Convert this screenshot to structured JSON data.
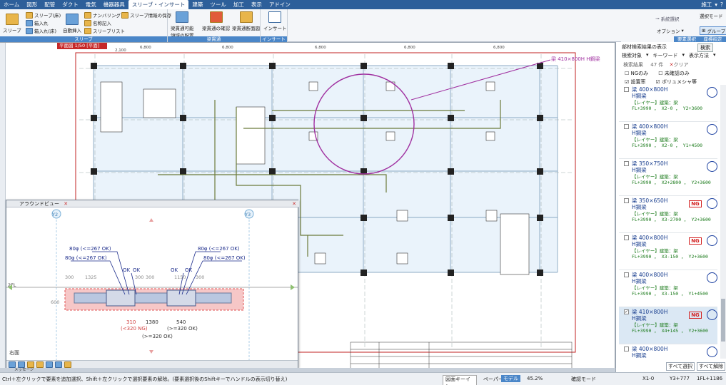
{
  "menu": {
    "items": [
      "ホーム",
      "図形",
      "配管",
      "ダクト",
      "電気",
      "機器器具",
      "スリーブ・インサート",
      "建築",
      "ツール",
      "加工",
      "表示",
      "アドイン"
    ],
    "active_index": 6,
    "right_label": "施工"
  },
  "ribbon": {
    "groups": [
      {
        "caption": "スリーブ",
        "buttons": [
          "スリーブ",
          "スリーブ(床)",
          "箱入れ",
          "箱入れ(床)",
          "自動挿入",
          "ナンバリング",
          "名称記入",
          "スリーブリスト",
          "スリーブ情報の保存"
        ]
      },
      {
        "caption": "梁貫通",
        "buttons": [
          "梁貫通可能\n領域の配置",
          "梁貫通の確認",
          "梁貫通断面図"
        ]
      },
      {
        "caption": "インサート",
        "buttons": [
          "インサート"
        ]
      }
    ],
    "right": {
      "system_select": "系統選択",
      "select_mode": "選択モード",
      "option": "オプション",
      "group": "グループ",
      "caption1": "要素選択",
      "caption2": "座標指定"
    }
  },
  "drawing": {
    "tab": "平面図 1/50 [平面]",
    "callout": "梁 410×800H H鋼梁",
    "dims_top": [
      "2,100",
      "6,800",
      "6,800",
      "6,800",
      "6,800",
      "6,800",
      "6,800",
      "2,100"
    ],
    "grid_top": [
      "X1",
      "X2",
      "X3",
      "X4",
      "X5",
      "X6"
    ],
    "grid_left": [
      "Y3",
      "Y2",
      "Y1"
    ]
  },
  "popup": {
    "title": "アラウンドビュー",
    "grid_left": "Y2",
    "grid_right": "Y3",
    "level": "2FL",
    "labels": [
      "80φ (<=267 OK)",
      "80φ (<=267 OK)",
      "80φ (<=267 OK)",
      "80φ (<=267 OK)",
      "OK",
      "OK",
      "OK",
      "OK"
    ],
    "dims": [
      "300",
      "1325",
      "300",
      "300",
      "1150",
      "300",
      "600",
      "310",
      "1380",
      "540"
    ],
    "ng_text": "(<320 NG)",
    "ok_text1": "(>=320 OK)",
    "ok_text2": "(>=320 OK)",
    "bottom_label": "右面"
  },
  "panel": {
    "header": "部材検索結果の表示",
    "search_btn": "検索",
    "filters": [
      "検索対象",
      "キーワード",
      "表示方法"
    ],
    "result_label": "検索結果",
    "result_count": "47 件",
    "clear": "クリア",
    "checks": [
      "NGのみ",
      "未確認のみ",
      "設置率",
      "ボリュメシャ等"
    ],
    "cards": [
      {
        "l1": "梁 400×800H",
        "l2": "H鋼梁",
        "l3": "【レイヤー】建築：梁",
        "l4": "FL+3990 ， X2-0 ， Y2+3600",
        "ng": false,
        "sel": false
      },
      {
        "l1": "梁 400×800H",
        "l2": "H鋼梁",
        "l3": "【レイヤー】建築：梁",
        "l4": "FL+3990 ， X2-0 ， Y1+4500",
        "ng": false,
        "sel": false
      },
      {
        "l1": "梁 350×750H",
        "l2": "H鋼梁",
        "l3": "【レイヤー】建築：梁",
        "l4": "FL+3990 ， X2+2800 ， Y2+3600",
        "ng": false,
        "sel": false
      },
      {
        "l1": "梁 350×650H",
        "l2": "H鋼梁",
        "l3": "【レイヤー】建築：梁",
        "l4": "FL+3990 ， X3-2700 ， Y2+3600",
        "ng": true,
        "sel": false
      },
      {
        "l1": "梁 400×800H",
        "l2": "H鋼梁",
        "l3": "【レイヤー】建築：梁",
        "l4": "FL+3990 ， X3-150 ， Y2+3600",
        "ng": true,
        "sel": false
      },
      {
        "l1": "梁 400×800H",
        "l2": "H鋼梁",
        "l3": "【レイヤー】建築：梁",
        "l4": "FL+3990 ， X3-150 ， Y1+4500",
        "ng": false,
        "sel": false
      },
      {
        "l1": "梁 410×800H",
        "l2": "H鋼梁",
        "l3": "【レイヤー】建築：梁",
        "l4": "FL+3990 ， X4+145 ， Y2+3600",
        "ng": true,
        "sel": true
      },
      {
        "l1": "梁 400×800H",
        "l2": "H鋼梁",
        "l3": "【レイヤー】建築：梁",
        "l4": "FL+3990 ， X4+145 ， Y1+4500",
        "ng": false,
        "sel": false
      }
    ],
    "select_all": "すべて選択",
    "deselect_all": "すべて解除"
  },
  "status": {
    "hint": "Ctrl＋左クリックで要素を追加選択、Shift＋左クリックで選択要素の解除。(要素選択後のShiftキーでハンドルの表示切り替え)",
    "key_in": "図面キーイン",
    "paper": "ペーパー",
    "model": "モデル",
    "zoom": "45.2%",
    "confirm_mode": "確認モード",
    "x": "X1-0",
    "y": "Y3+777",
    "fl": "1FL+1186"
  },
  "message": "メッセージ"
}
